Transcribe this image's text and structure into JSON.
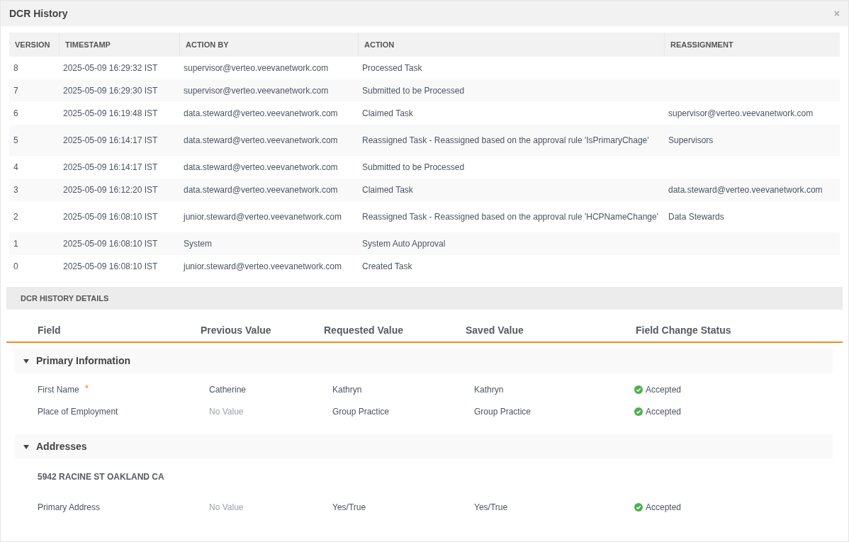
{
  "window": {
    "title": "DCR History",
    "close": "×"
  },
  "history": {
    "columns": [
      "VERSION",
      "TIMESTAMP",
      "ACTION BY",
      "ACTION",
      "REASSIGNMENT"
    ],
    "rows": [
      {
        "version": "8",
        "timestamp": "2025-05-09 16:29:32 IST",
        "action_by": "supervisor@verteo.veevanetwork.com",
        "action": "Processed Task",
        "reassignment": ""
      },
      {
        "version": "7",
        "timestamp": "2025-05-09 16:29:30 IST",
        "action_by": "supervisor@verteo.veevanetwork.com",
        "action": "Submitted to be Processed",
        "reassignment": ""
      },
      {
        "version": "6",
        "timestamp": "2025-05-09 16:19:48 IST",
        "action_by": "data.steward@verteo.veevanetwork.com",
        "action": "Claimed Task",
        "reassignment": "supervisor@verteo.veevanetwork.com"
      },
      {
        "version": "5",
        "timestamp": "2025-05-09 16:14:17 IST",
        "action_by": "data.steward@verteo.veevanetwork.com",
        "action": "Reassigned Task - Reassigned based on the approval rule 'IsPrimaryChage'",
        "reassignment": "Supervisors"
      },
      {
        "version": "4",
        "timestamp": "2025-05-09 16:14:17 IST",
        "action_by": "data.steward@verteo.veevanetwork.com",
        "action": "Submitted to be Processed",
        "reassignment": ""
      },
      {
        "version": "3",
        "timestamp": "2025-05-09 16:12:20 IST",
        "action_by": "data.steward@verteo.veevanetwork.com",
        "action": "Claimed Task",
        "reassignment": "data.steward@verteo.veevanetwork.com"
      },
      {
        "version": "2",
        "timestamp": "2025-05-09 16:08:10 IST",
        "action_by": "junior.steward@verteo.veevanetwork.com",
        "action": "Reassigned Task - Reassigned based on the approval rule 'HCPNameChange'",
        "reassignment": "Data Stewards"
      },
      {
        "version": "1",
        "timestamp": "2025-05-09 16:08:10 IST",
        "action_by": "System",
        "action": "System Auto Approval",
        "reassignment": ""
      },
      {
        "version": "0",
        "timestamp": "2025-05-09 16:08:10 IST",
        "action_by": "junior.steward@verteo.veevanetwork.com",
        "action": "Created Task",
        "reassignment": ""
      }
    ]
  },
  "details": {
    "title": "DCR HISTORY DETAILS",
    "columns": [
      "Field",
      "Previous Value",
      "Requested Value",
      "Saved Value",
      "Field Change Status"
    ],
    "required_mark": "*",
    "groups": [
      {
        "title": "Primary Information",
        "expanded": true,
        "items": [
          {
            "kind": "field",
            "field": "First Name",
            "required": true,
            "previous": "Catherine",
            "previous_empty": false,
            "requested": "Kathryn",
            "saved": "Kathryn",
            "status": "Accepted",
            "accepted": true
          },
          {
            "kind": "field",
            "field": "Place of Employment",
            "required": false,
            "previous": "No Value",
            "previous_empty": true,
            "requested": "Group Practice",
            "saved": "Group Practice",
            "status": "Accepted",
            "accepted": true
          }
        ]
      },
      {
        "title": "Addresses",
        "expanded": true,
        "items": [
          {
            "kind": "subheading",
            "field": "5942 RACINE ST OAKLAND CA"
          },
          {
            "kind": "field",
            "field": "Primary Address",
            "required": false,
            "previous": "No Value",
            "previous_empty": true,
            "requested": "Yes/True",
            "saved": "Yes/True",
            "status": "Accepted",
            "accepted": true
          }
        ]
      }
    ]
  }
}
